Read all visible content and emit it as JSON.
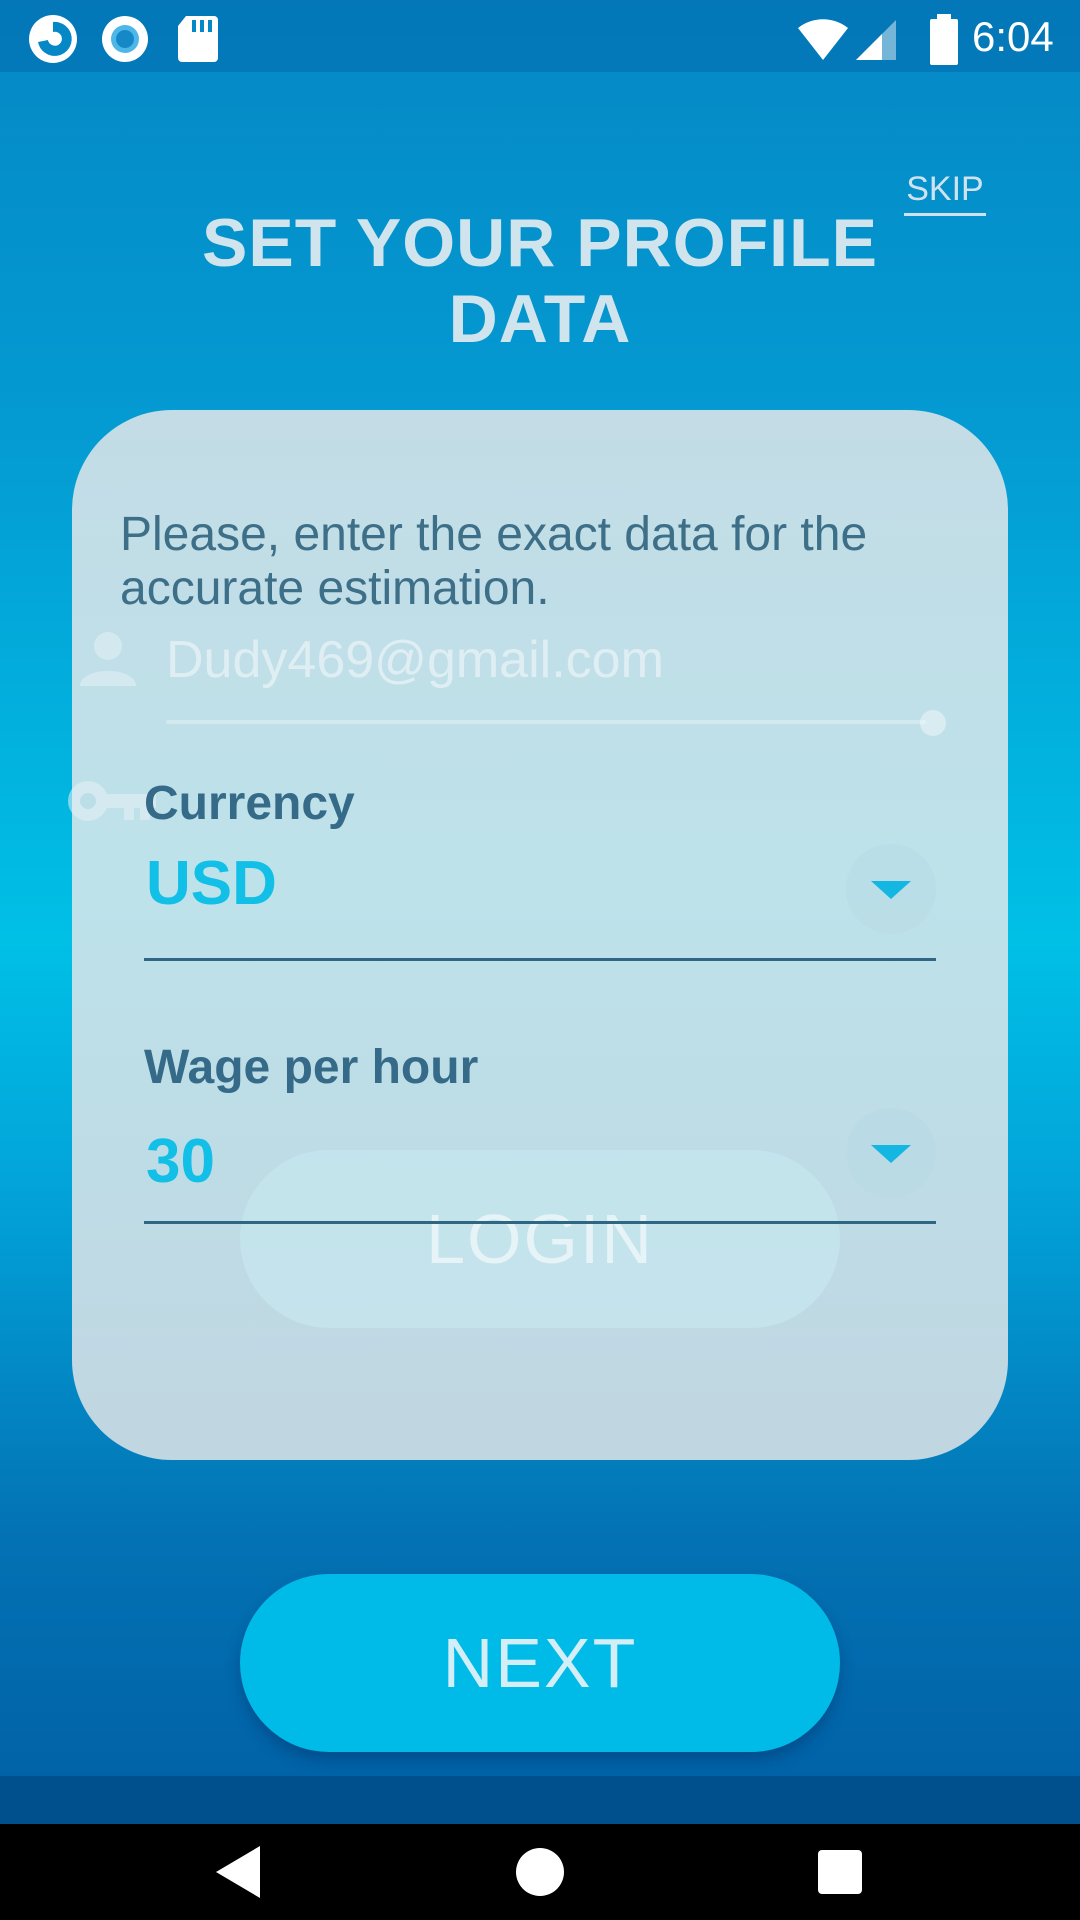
{
  "status_bar": {
    "time": "6:04",
    "icons": [
      "app-notification-icon",
      "radio-notification-icon",
      "sd-card-icon",
      "wifi-icon",
      "cell-signal-icon",
      "battery-icon"
    ]
  },
  "header": {
    "skip_label": "SKIP",
    "title": "SET YOUR PROFILE DATA"
  },
  "card": {
    "intro_text": "Please, enter the exact data for the accurate estimation.",
    "fields": [
      {
        "label": "Currency",
        "value": "USD"
      },
      {
        "label": "Wage per hour",
        "value": "30"
      }
    ]
  },
  "background_login": {
    "email_text": "Dudy469@gmail.com",
    "login_label": "LOGIN"
  },
  "actions": {
    "next_label": "NEXT"
  },
  "colors": {
    "accent": "#00bbe8",
    "value_text": "#12bfe6",
    "label_text": "#356b88"
  },
  "nav_bar": {
    "icons": [
      "back-icon",
      "home-icon",
      "recents-icon"
    ]
  }
}
